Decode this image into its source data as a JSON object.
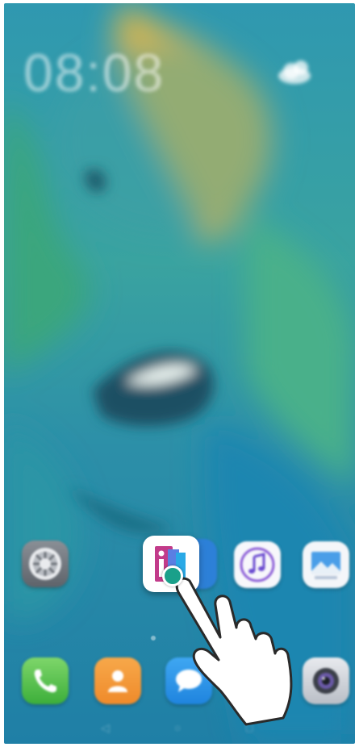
{
  "status": {
    "left": "",
    "right": ""
  },
  "lock": {
    "time": "08:08",
    "date": "",
    "temp": ""
  },
  "apps": [
    {
      "label": "",
      "icon": "settings-icon"
    },
    {
      "label": "",
      "icon": "tips-icon"
    },
    {
      "label": "",
      "icon": "music-icon"
    },
    {
      "label": "",
      "icon": "gallery-icon"
    }
  ],
  "dock": [
    {
      "icon": "phone-icon"
    },
    {
      "icon": "contacts-icon"
    },
    {
      "icon": "messages-icon"
    },
    {
      "icon": "camera-icon"
    }
  ],
  "colors": {
    "wallpaper_base": "#2a8fa0",
    "wallpaper_gold": "#d8b54a",
    "tap_indicator": "#1aa08a"
  }
}
